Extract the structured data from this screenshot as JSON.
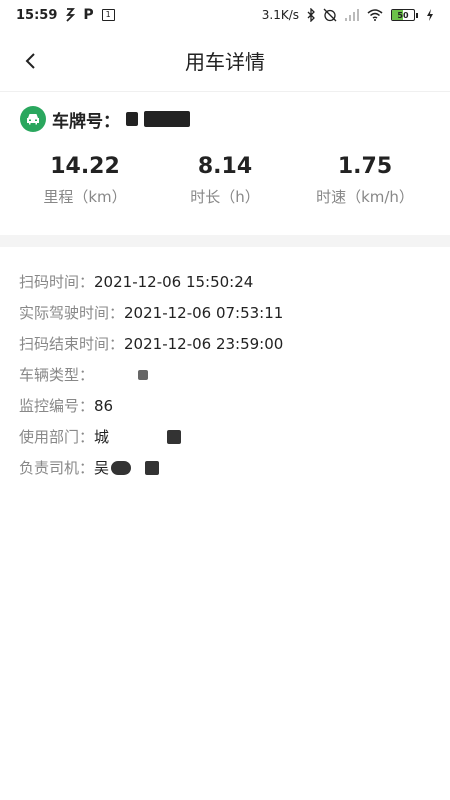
{
  "status_bar": {
    "time": "15:59",
    "network_speed": "3.1K/s",
    "battery_level": "50"
  },
  "header": {
    "title": "用车详情"
  },
  "vehicle": {
    "plate_label": "车牌号："
  },
  "stats": [
    {
      "value": "14.22",
      "label": "里程（km）"
    },
    {
      "value": "8.14",
      "label": "时长（h）"
    },
    {
      "value": "1.75",
      "label": "时速（km/h）"
    }
  ],
  "details": [
    {
      "label": "扫码时间：",
      "value": "2021-12-06 15:50:24"
    },
    {
      "label": "实际驾驶时间：",
      "value": "2021-12-06 07:53:11"
    },
    {
      "label": "扫码结束时间：",
      "value": "2021-12-06 23:59:00"
    },
    {
      "label": "车辆类型：",
      "value": ""
    },
    {
      "label": "监控编号：",
      "value": "86"
    },
    {
      "label": "使用部门：",
      "value": "城"
    },
    {
      "label": "负责司机：",
      "value": "吴"
    }
  ],
  "colors": {
    "accent_green": "#2aa75e",
    "label_gray": "#888888",
    "value_dark": "#222222",
    "band_gray": "#f4f4f4"
  }
}
